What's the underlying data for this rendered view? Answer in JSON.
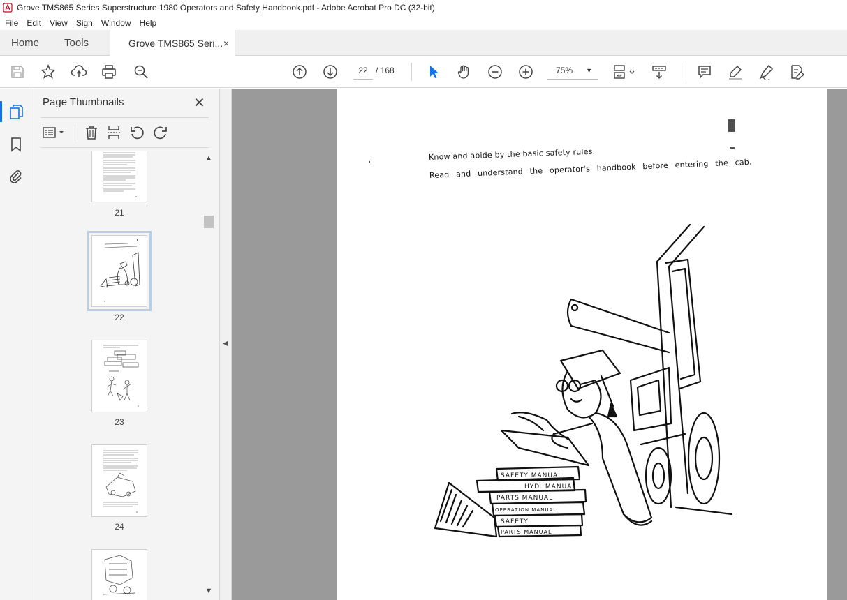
{
  "window": {
    "title": "Grove TMS865 Series Superstructure 1980 Operators and Safety Handbook.pdf - Adobe Acrobat Pro DC (32-bit)"
  },
  "menu": {
    "items": [
      {
        "label": "File"
      },
      {
        "label": "Edit"
      },
      {
        "label": "View"
      },
      {
        "label": "Sign"
      },
      {
        "label": "Window"
      },
      {
        "label": "Help"
      }
    ]
  },
  "tabs": {
    "home": "Home",
    "tools": "Tools",
    "document": "Grove TMS865 Seri...",
    "close": "×"
  },
  "toolbar": {
    "page_current": "22",
    "page_total": "/ 168",
    "zoom": "75%",
    "zoom_caret": "▼"
  },
  "panel": {
    "title": "Page Thumbnails",
    "close": "✕",
    "thumbnails": [
      {
        "label": "21"
      },
      {
        "label": "22"
      },
      {
        "label": "23"
      },
      {
        "label": "24"
      }
    ]
  },
  "document": {
    "line1": "Know and abide by the basic safety rules.",
    "line2": "Read and understand the operator's handbook before entering the cab.",
    "books": [
      {
        "label": "SAFETY MANUAL"
      },
      {
        "label": "HYD. MANUAL"
      },
      {
        "label": "PARTS MANUAL"
      },
      {
        "label": "OPERATION MANUAL"
      },
      {
        "label": "SAFETY"
      },
      {
        "label": "PARTS MANUAL"
      }
    ]
  },
  "colors": {
    "accent": "#1473e6",
    "doc_background": "#9a9a9a",
    "panel_background": "#f4f4f4"
  }
}
